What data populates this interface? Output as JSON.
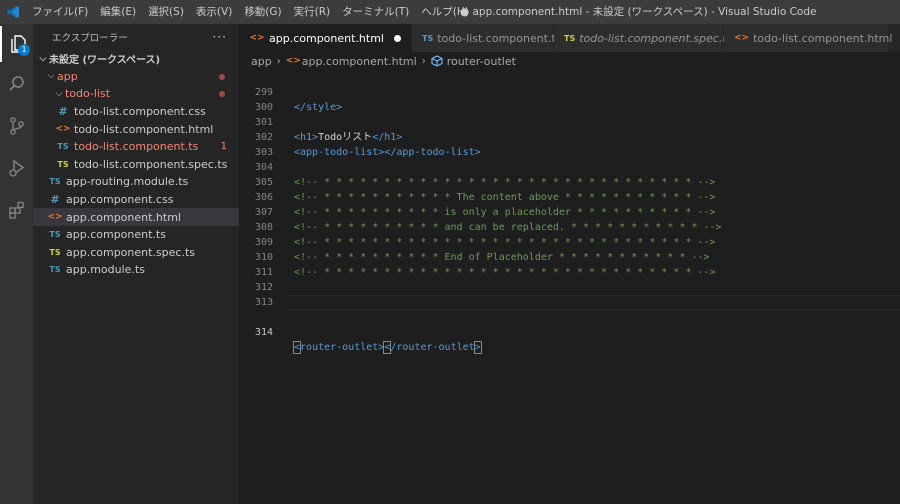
{
  "window": {
    "title": "● app.component.html - 未設定 (ワークスペース) - Visual Studio Code",
    "menu": [
      "ファイル(F)",
      "編集(E)",
      "選択(S)",
      "表示(V)",
      "移動(G)",
      "実行(R)",
      "ターミナル(T)",
      "ヘルプ(H)"
    ]
  },
  "activity": {
    "explorer_badge": "1"
  },
  "sidebar": {
    "title": "エクスプローラー",
    "more": "···",
    "workspace": "未設定 (ワークスペース)",
    "app_folder": "app",
    "todo_folder": "todo-list",
    "files": {
      "todo_css": "todo-list.component.css",
      "todo_html": "todo-list.component.html",
      "todo_ts": "todo-list.component.ts",
      "todo_ts_errors": "1",
      "todo_spec": "todo-list.component.spec.ts",
      "routing": "app-routing.module.ts",
      "app_css": "app.component.css",
      "app_html": "app.component.html",
      "app_ts": "app.component.ts",
      "app_spec": "app.component.spec.ts",
      "app_module": "app.module.ts"
    },
    "icons": {
      "css": "#",
      "html": "<>",
      "ts": "TS"
    }
  },
  "tabs": [
    {
      "label": "app.component.html",
      "icon": "<>"
    },
    {
      "label": "todo-list.component.ts",
      "icon": "TS"
    },
    {
      "label": "todo-list.component.spec.ts",
      "icon": "TS"
    },
    {
      "label": "todo-list.component.html",
      "icon": "<>"
    }
  ],
  "breadcrumb": {
    "folder": "app",
    "file": "app.component.html",
    "symbol": "router-outlet",
    "file_icon": "<>"
  },
  "editor": {
    "lines": {
      "n299": "299",
      "n300": "300",
      "n301": "301",
      "n302": "302",
      "n303": "303",
      "n304": "304",
      "n305": "305",
      "n306": "306",
      "n307": "307",
      "n308": "308",
      "n309": "309",
      "n310": "310",
      "n311": "311",
      "n312": "312",
      "n313": "313",
      "n314": "314"
    },
    "code": {
      "style_close": "</style>",
      "h1_open": "<h1>",
      "h1_text": "Todoリスト",
      "h1_close": "</h1>",
      "app_todo_open": "<app-todo-list>",
      "app_todo_close": "</app-todo-list>",
      "c304": "<!-- * * * * * * * * * * * * * * * * * * * * * * * * * * * * * * * -->",
      "c305": "<!-- * * * * * * * * * * * The content above * * * * * * * * * * * -->",
      "c306": "<!-- * * * * * * * * * * is only a placeholder * * * * * * * * * * -->",
      "c307": "<!-- * * * * * * * * * * and can be replaced. * * * * * * * * * * * -->",
      "c308": "<!-- * * * * * * * * * * * * * * * * * * * * * * * * * * * * * * * -->",
      "c309": "<!-- * * * * * * * * * * End of Placeholder * * * * * * * * * * * -->",
      "c310": "<!-- * * * * * * * * * * * * * * * * * * * * * * * * * * * * * * * -->",
      "ro_lt": "<",
      "ro_open_name": "router-outlet",
      "ro_gt": ">",
      "ro_close_lt": "<",
      "ro_close_name": "/router-outlet",
      "ro_close_gt": ">"
    }
  }
}
